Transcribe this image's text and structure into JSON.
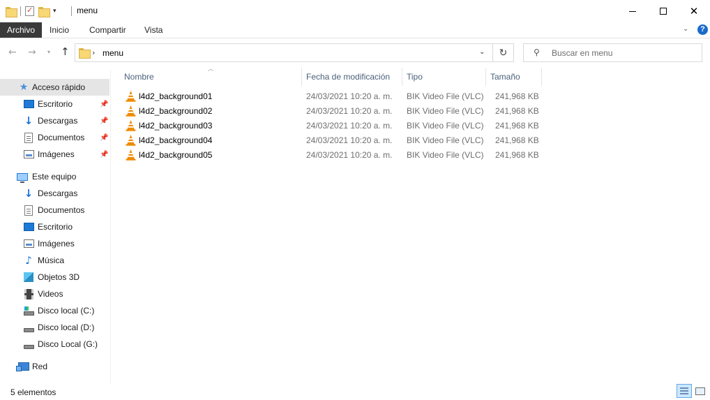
{
  "window": {
    "title": "menu",
    "controls": {
      "minimize": "minimize-icon",
      "maximize": "maximize-icon",
      "close": "close-icon"
    }
  },
  "ribbon": {
    "tabs": [
      {
        "label": "Archivo",
        "active": true
      },
      {
        "label": "Inicio"
      },
      {
        "label": "Compartir"
      },
      {
        "label": "Vista"
      }
    ],
    "help": "?"
  },
  "address": {
    "path": "menu",
    "search_placeholder": "Buscar en menu"
  },
  "sidebar": {
    "quick_access": {
      "label": "Acceso rápido",
      "icon": "star-icon"
    },
    "quick_items": [
      {
        "label": "Escritorio",
        "icon": "desktop-icon"
      },
      {
        "label": "Descargas",
        "icon": "downloads-icon"
      },
      {
        "label": "Documentos",
        "icon": "documents-icon"
      },
      {
        "label": "Imágenes",
        "icon": "pictures-icon"
      }
    ],
    "this_pc": {
      "label": "Este equipo",
      "icon": "computer-icon"
    },
    "pc_items": [
      {
        "label": "Descargas",
        "icon": "downloads-icon"
      },
      {
        "label": "Documentos",
        "icon": "documents-icon"
      },
      {
        "label": "Escritorio",
        "icon": "desktop-icon"
      },
      {
        "label": "Imágenes",
        "icon": "pictures-icon"
      },
      {
        "label": "Música",
        "icon": "music-icon"
      },
      {
        "label": "Objetos 3D",
        "icon": "3d-objects-icon"
      },
      {
        "label": "Videos",
        "icon": "videos-icon"
      },
      {
        "label": "Disco local (C:)",
        "icon": "drive-c-icon"
      },
      {
        "label": "Disco local (D:)",
        "icon": "drive-icon"
      },
      {
        "label": "Disco Local (G:)",
        "icon": "drive-icon"
      }
    ],
    "network": {
      "label": "Red",
      "icon": "network-icon"
    }
  },
  "columns": {
    "name": "Nombre",
    "date": "Fecha de modificación",
    "type": "Tipo",
    "size": "Tamaño"
  },
  "files": [
    {
      "name": "l4d2_background01",
      "date": "24/03/2021 10:20 a. m.",
      "type": "BIK Video File (VLC)",
      "size": "241,968 KB"
    },
    {
      "name": "l4d2_background02",
      "date": "24/03/2021 10:20 a. m.",
      "type": "BIK Video File (VLC)",
      "size": "241,968 KB"
    },
    {
      "name": "l4d2_background03",
      "date": "24/03/2021 10:20 a. m.",
      "type": "BIK Video File (VLC)",
      "size": "241,968 KB"
    },
    {
      "name": "l4d2_background04",
      "date": "24/03/2021 10:20 a. m.",
      "type": "BIK Video File (VLC)",
      "size": "241,968 KB"
    },
    {
      "name": "l4d2_background05",
      "date": "24/03/2021 10:20 a. m.",
      "type": "BIK Video File (VLC)",
      "size": "241,968 KB"
    }
  ],
  "status": {
    "count": "5 elementos"
  },
  "colors": {
    "file_tab": "#3a3a3a",
    "selected_nav": "#e5e5e5",
    "accent_blue": "#1b6ac9",
    "vlc_orange": "#f08a00"
  }
}
